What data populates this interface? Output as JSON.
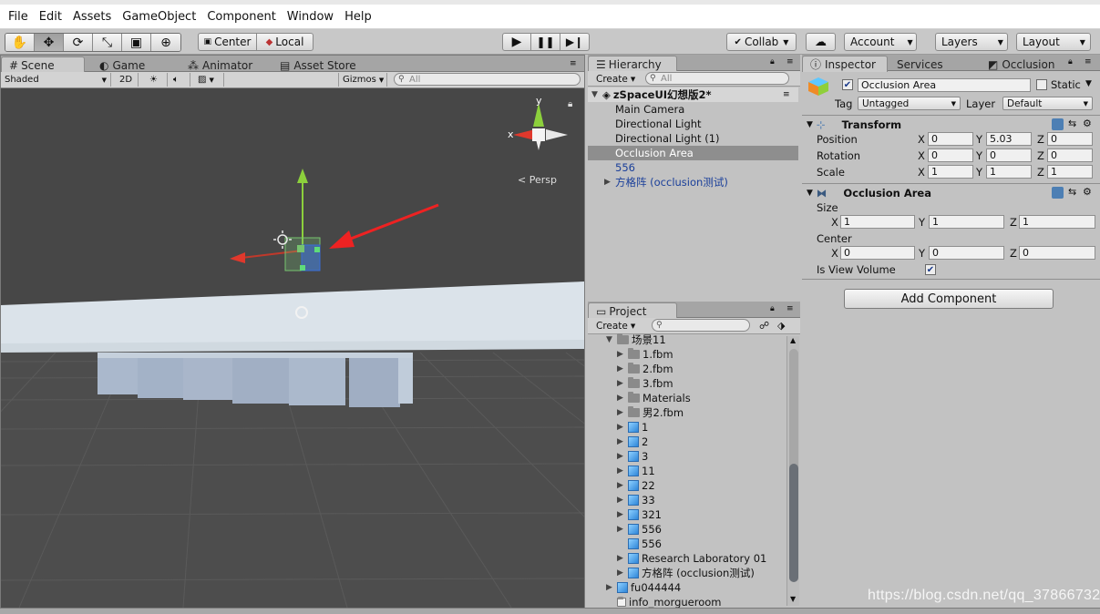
{
  "menu": [
    "File",
    "Edit",
    "Assets",
    "GameObject",
    "Component",
    "Window",
    "Help"
  ],
  "toolbar": {
    "tools": [
      {
        "name": "hand-tool-icon",
        "glyph": "✋"
      },
      {
        "name": "move-tool-icon",
        "glyph": "✥"
      },
      {
        "name": "rotate-tool-icon",
        "glyph": "⟳"
      },
      {
        "name": "scale-tool-icon",
        "glyph": "⤡"
      },
      {
        "name": "rect-tool-icon",
        "glyph": "▣"
      },
      {
        "name": "transform-tool-icon",
        "glyph": "⊕"
      }
    ],
    "pivot": "Center",
    "space": "Local",
    "collab": "Collab",
    "account": "Account",
    "layers": "Layers",
    "layout": "Layout"
  },
  "scene": {
    "tabs": [
      "Scene",
      "Game",
      "Animator",
      "Asset Store"
    ],
    "shading": "Shaded",
    "mode2d": "2D",
    "gizmos": "Gizmos",
    "search_placeholder": "All",
    "persp": "Persp",
    "axis_x": "x",
    "axis_y": "y"
  },
  "hierarchy": {
    "tab": "Hierarchy",
    "create": "Create",
    "search_placeholder": "All",
    "scene_name": "zSpaceUI幻想版2*",
    "items": [
      {
        "label": "Main Camera",
        "selected": false,
        "color": "#111111",
        "expandable": false
      },
      {
        "label": "Directional Light",
        "selected": false,
        "color": "#111111",
        "expandable": false
      },
      {
        "label": "Directional Light (1)",
        "selected": false,
        "color": "#111111",
        "expandable": false
      },
      {
        "label": "Occlusion Area",
        "selected": true,
        "color": "#ffffff",
        "expandable": false
      },
      {
        "label": "556",
        "selected": false,
        "color": "#1a3f9a",
        "expandable": false
      },
      {
        "label": "方格阵 (occlusion测试)",
        "selected": false,
        "color": "#1a3f9a",
        "expandable": true
      }
    ]
  },
  "project": {
    "tab": "Project",
    "create": "Create",
    "root": "场景11",
    "items": [
      {
        "label": "1.fbm",
        "type": "folder",
        "indent": 1
      },
      {
        "label": "2.fbm",
        "type": "folder",
        "indent": 1
      },
      {
        "label": "3.fbm",
        "type": "folder",
        "indent": 1
      },
      {
        "label": "Materials",
        "type": "folder",
        "indent": 1
      },
      {
        "label": "男2.fbm",
        "type": "folder",
        "indent": 1
      },
      {
        "label": "1",
        "type": "prefab",
        "indent": 1
      },
      {
        "label": "2",
        "type": "prefab",
        "indent": 1
      },
      {
        "label": "3",
        "type": "prefab",
        "indent": 1
      },
      {
        "label": "11",
        "type": "prefab",
        "indent": 1
      },
      {
        "label": "22",
        "type": "prefab",
        "indent": 1
      },
      {
        "label": "33",
        "type": "prefab",
        "indent": 1
      },
      {
        "label": "321",
        "type": "prefab",
        "indent": 1
      },
      {
        "label": "556",
        "type": "prefab",
        "indent": 1
      },
      {
        "label": "556",
        "type": "scene-prefab",
        "indent": 1
      },
      {
        "label": "Research Laboratory 01",
        "type": "prefab",
        "indent": 1
      },
      {
        "label": "方格阵 (occlusion测试)",
        "type": "prefab",
        "indent": 1
      },
      {
        "label": "fu044444",
        "type": "prefab",
        "indent": 0
      },
      {
        "label": "info_morgueroom",
        "type": "file",
        "indent": 0
      }
    ]
  },
  "inspector": {
    "tabs": [
      "Inspector",
      "Services",
      "Occlusion"
    ],
    "object_name": "Occlusion Area",
    "static_label": "Static",
    "tag_label": "Tag",
    "tag_value": "Untagged",
    "layer_label": "Layer",
    "layer_value": "Default",
    "transform": {
      "title": "Transform",
      "rows": [
        {
          "label": "Position",
          "x": "0",
          "y": "5.03",
          "z": "0"
        },
        {
          "label": "Rotation",
          "x": "0",
          "y": "0",
          "z": "0"
        },
        {
          "label": "Scale",
          "x": "1",
          "y": "1",
          "z": "1"
        }
      ]
    },
    "occlusion": {
      "title": "Occlusion Area",
      "size_label": "Size",
      "size": {
        "x": "1",
        "y": "1",
        "z": "1"
      },
      "center_label": "Center",
      "center": {
        "x": "0",
        "y": "0",
        "z": "0"
      },
      "view_volume_label": "Is View Volume",
      "view_volume": true
    },
    "add_component": "Add Component",
    "axis": {
      "x": "X",
      "y": "Y",
      "z": "Z"
    }
  },
  "watermark": "https://blog.csdn.net/qq_37866732"
}
